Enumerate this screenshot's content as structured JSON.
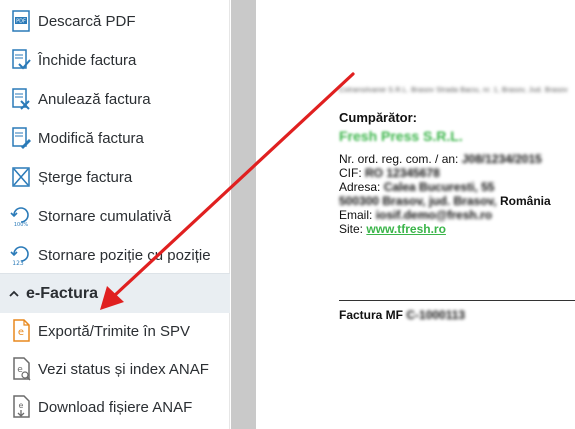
{
  "sidebar": {
    "items": [
      {
        "label": "Descarcă PDF",
        "icon": "pdf-file-icon"
      },
      {
        "label": "Închide factura",
        "icon": "close-invoice-icon"
      },
      {
        "label": "Anulează factura",
        "icon": "cancel-invoice-icon"
      },
      {
        "label": "Modifică factura",
        "icon": "edit-invoice-icon"
      },
      {
        "label": "Șterge factura",
        "icon": "delete-invoice-icon"
      },
      {
        "label": "Stornare cumulativă",
        "icon": "storno-cumulative-icon"
      },
      {
        "label": "Stornare poziție cu poziție",
        "icon": "storno-position-icon"
      }
    ],
    "section": {
      "label": "e-Factura",
      "icon": "chevron-up-icon",
      "items": [
        {
          "label": "Exportă/Trimite în SPV",
          "icon": "export-spv-icon"
        },
        {
          "label": "Vezi status și index ANAF",
          "icon": "status-anaf-icon"
        },
        {
          "label": "Download fișiere ANAF",
          "icon": "download-anaf-icon"
        }
      ]
    }
  },
  "document": {
    "header_line": "Cotransilvanie S.R.L. Brasov Strada Baciu, nr. 1, Brasov, Jud. Brasov",
    "buyer_title": "Cumpărător:",
    "buyer_name": "Fresh Press S.R.L.",
    "reg_label": "Nr. ord. reg. com. / an:",
    "reg_value": "J08/1234/2015",
    "cif_label": "CIF:",
    "cif_value": "RO 12345678",
    "address_label": "Adresa:",
    "address_value": "Calea Bucuresti, 55",
    "address_line2": "500300 Brasov, jud. Brasov,",
    "country": "România",
    "email_label": "Email:",
    "email_value": "iosif.demo@fresh.ro",
    "site_label": "Site:",
    "site_value": "www.tfresh.ro",
    "invoice_label": "Factura MF",
    "invoice_number": "C-1000113"
  },
  "colors": {
    "arrow": "#e02020",
    "section_bg": "#e9eef2",
    "icon_blue": "#2a7ab8",
    "icon_orange": "#e8891e",
    "green_text": "#3bb54a"
  }
}
